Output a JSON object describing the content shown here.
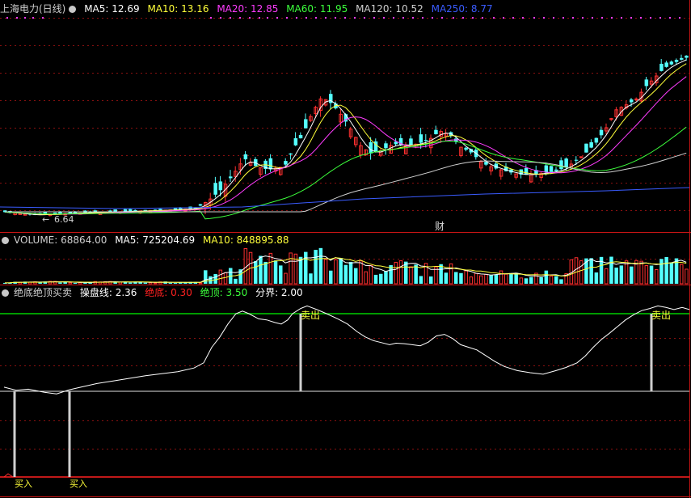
{
  "colors": {
    "up": "#ff3030",
    "down": "#54ffff",
    "ma5": "#ffffff",
    "ma10": "#ffff3a",
    "ma20": "#ff3cff",
    "ma60": "#3cff3c",
    "ma120": "#d0d0d0",
    "ma250": "#3a5cff",
    "line_green": "#00d000",
    "line_red": "#ff2020",
    "bottom_marker": "#ff3030",
    "divider": "#c81414"
  },
  "panel1": {
    "title": "上海电力(日线)",
    "ma5": "MA5: 12.69",
    "ma10": "MA10: 13.16",
    "ma20": "MA20: 12.85",
    "ma60": "MA60: 11.95",
    "ma120": "MA120: 10.52",
    "ma250": "MA250: 8.77",
    "low_label": "6.64",
    "cai_label": "财"
  },
  "panel2": {
    "volume": "VOLUME: 68864.00",
    "ma5": "MA5: 725204.69",
    "ma10": "MA10: 848895.88"
  },
  "panel3": {
    "title": "绝底绝顶买卖",
    "caopan": "操盘线: 2.36",
    "juedi": "绝底: 0.30",
    "jueding": "绝顶: 3.50",
    "fenjie": "分界: 2.00",
    "signals": [
      {
        "label": "买入",
        "x": 18,
        "kind": "buy"
      },
      {
        "label": "买入",
        "x": 86,
        "kind": "buy"
      },
      {
        "label": "卖出",
        "x": 372,
        "kind": "sell"
      },
      {
        "label": "卖出",
        "x": 806,
        "kind": "sell"
      }
    ]
  },
  "chart_data": {
    "type": "line",
    "series": [
      {
        "name": "操盘线",
        "points": [
          [
            5,
            2.08
          ],
          [
            20,
            2.02
          ],
          [
            35,
            2.04
          ],
          [
            55,
            1.98
          ],
          [
            70,
            1.95
          ],
          [
            86,
            2.03
          ],
          [
            100,
            2.08
          ],
          [
            120,
            2.15
          ],
          [
            140,
            2.2
          ],
          [
            160,
            2.25
          ],
          [
            180,
            2.3
          ],
          [
            205,
            2.35
          ],
          [
            220,
            2.38
          ],
          [
            240,
            2.45
          ],
          [
            252,
            2.55
          ],
          [
            262,
            2.85
          ],
          [
            272,
            3.05
          ],
          [
            282,
            3.3
          ],
          [
            292,
            3.5
          ],
          [
            300,
            3.55
          ],
          [
            308,
            3.5
          ],
          [
            320,
            3.4
          ],
          [
            330,
            3.38
          ],
          [
            340,
            3.33
          ],
          [
            348,
            3.3
          ],
          [
            356,
            3.38
          ],
          [
            362,
            3.5
          ],
          [
            372,
            3.6
          ],
          [
            380,
            3.65
          ],
          [
            392,
            3.58
          ],
          [
            404,
            3.5
          ],
          [
            418,
            3.4
          ],
          [
            430,
            3.3
          ],
          [
            442,
            3.15
          ],
          [
            452,
            3.05
          ],
          [
            462,
            2.98
          ],
          [
            472,
            2.94
          ],
          [
            482,
            2.9
          ],
          [
            490,
            2.93
          ],
          [
            500,
            2.92
          ],
          [
            510,
            2.9
          ],
          [
            520,
            2.88
          ],
          [
            530,
            2.95
          ],
          [
            540,
            3.07
          ],
          [
            550,
            3.1
          ],
          [
            560,
            3.02
          ],
          [
            570,
            2.9
          ],
          [
            580,
            2.85
          ],
          [
            590,
            2.8
          ],
          [
            600,
            2.7
          ],
          [
            612,
            2.58
          ],
          [
            624,
            2.48
          ],
          [
            640,
            2.4
          ],
          [
            656,
            2.36
          ],
          [
            672,
            2.33
          ],
          [
            688,
            2.4
          ],
          [
            700,
            2.46
          ],
          [
            714,
            2.55
          ],
          [
            724,
            2.68
          ],
          [
            734,
            2.85
          ],
          [
            744,
            3.0
          ],
          [
            754,
            3.12
          ],
          [
            764,
            3.25
          ],
          [
            774,
            3.38
          ],
          [
            784,
            3.48
          ],
          [
            794,
            3.56
          ],
          [
            804,
            3.6
          ],
          [
            814,
            3.65
          ],
          [
            824,
            3.62
          ],
          [
            834,
            3.58
          ],
          [
            844,
            3.62
          ],
          [
            853,
            3.58
          ]
        ]
      }
    ],
    "reference_lines": {
      "jueding": 3.5,
      "fenjie": 2.0,
      "juedi": 0.3
    }
  }
}
